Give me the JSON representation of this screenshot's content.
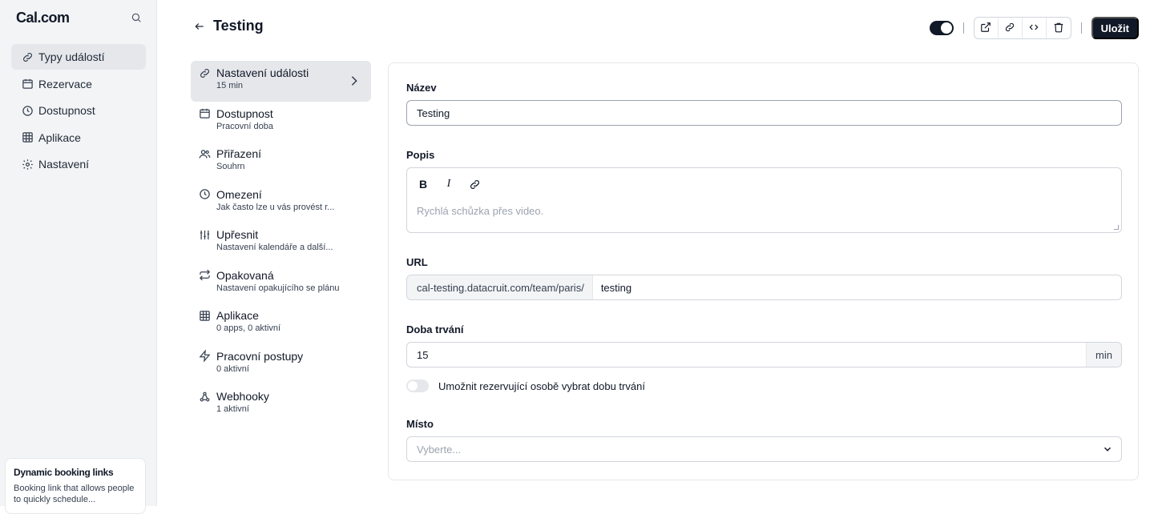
{
  "brand": {
    "name": "Cal.com"
  },
  "sidebar": {
    "items": [
      {
        "label": "Typy událostí",
        "icon": "link-icon",
        "active": true
      },
      {
        "label": "Rezervace",
        "icon": "calendar-icon"
      },
      {
        "label": "Dostupnost",
        "icon": "clock-icon"
      },
      {
        "label": "Aplikace",
        "icon": "grid-icon"
      },
      {
        "label": "Nastavení",
        "icon": "gear-icon"
      }
    ],
    "promo": {
      "title": "Dynamic booking links",
      "body": "Booking link that allows people to quickly schedule..."
    }
  },
  "header": {
    "title": "Testing",
    "save_label": "Uložit"
  },
  "settings_nav": [
    {
      "title": "Nastavení události",
      "subtitle": "15 min",
      "icon": "link-icon",
      "active": true
    },
    {
      "title": "Dostupnost",
      "subtitle": "Pracovní doba",
      "icon": "calendar-icon"
    },
    {
      "title": "Přiřazení",
      "subtitle": "Souhrn",
      "icon": "users-icon"
    },
    {
      "title": "Omezení",
      "subtitle": "Jak často lze u vás provést r...",
      "icon": "clock-icon"
    },
    {
      "title": "Upřesnit",
      "subtitle": "Nastavení kalendáře a další...",
      "icon": "sliders-icon"
    },
    {
      "title": "Opakovaná",
      "subtitle": "Nastavení opakujícího se plánu",
      "icon": "repeat-icon"
    },
    {
      "title": "Aplikace",
      "subtitle": "0 apps, 0 aktivní",
      "icon": "grid-icon"
    },
    {
      "title": "Pracovní postupy",
      "subtitle": "0 aktivní",
      "icon": "zap-icon"
    },
    {
      "title": "Webhooky",
      "subtitle": "1 aktivní",
      "icon": "webhook-icon"
    }
  ],
  "form": {
    "name_label": "Název",
    "name_value": "Testing",
    "description_label": "Popis",
    "description_placeholder": "Rychlá schůzka přes video.",
    "editor_bold": "B",
    "editor_italic": "I",
    "url_label": "URL",
    "url_prefix": "cal-testing.datacruit.com/team/paris/",
    "url_slug": "testing",
    "duration_label": "Doba trvání",
    "duration_value": "15",
    "duration_unit": "min",
    "duration_toggle_label": "Umožnit rezervující osobě vybrat dobu trvání",
    "location_label": "Místo",
    "location_placeholder": "Vyberte..."
  }
}
